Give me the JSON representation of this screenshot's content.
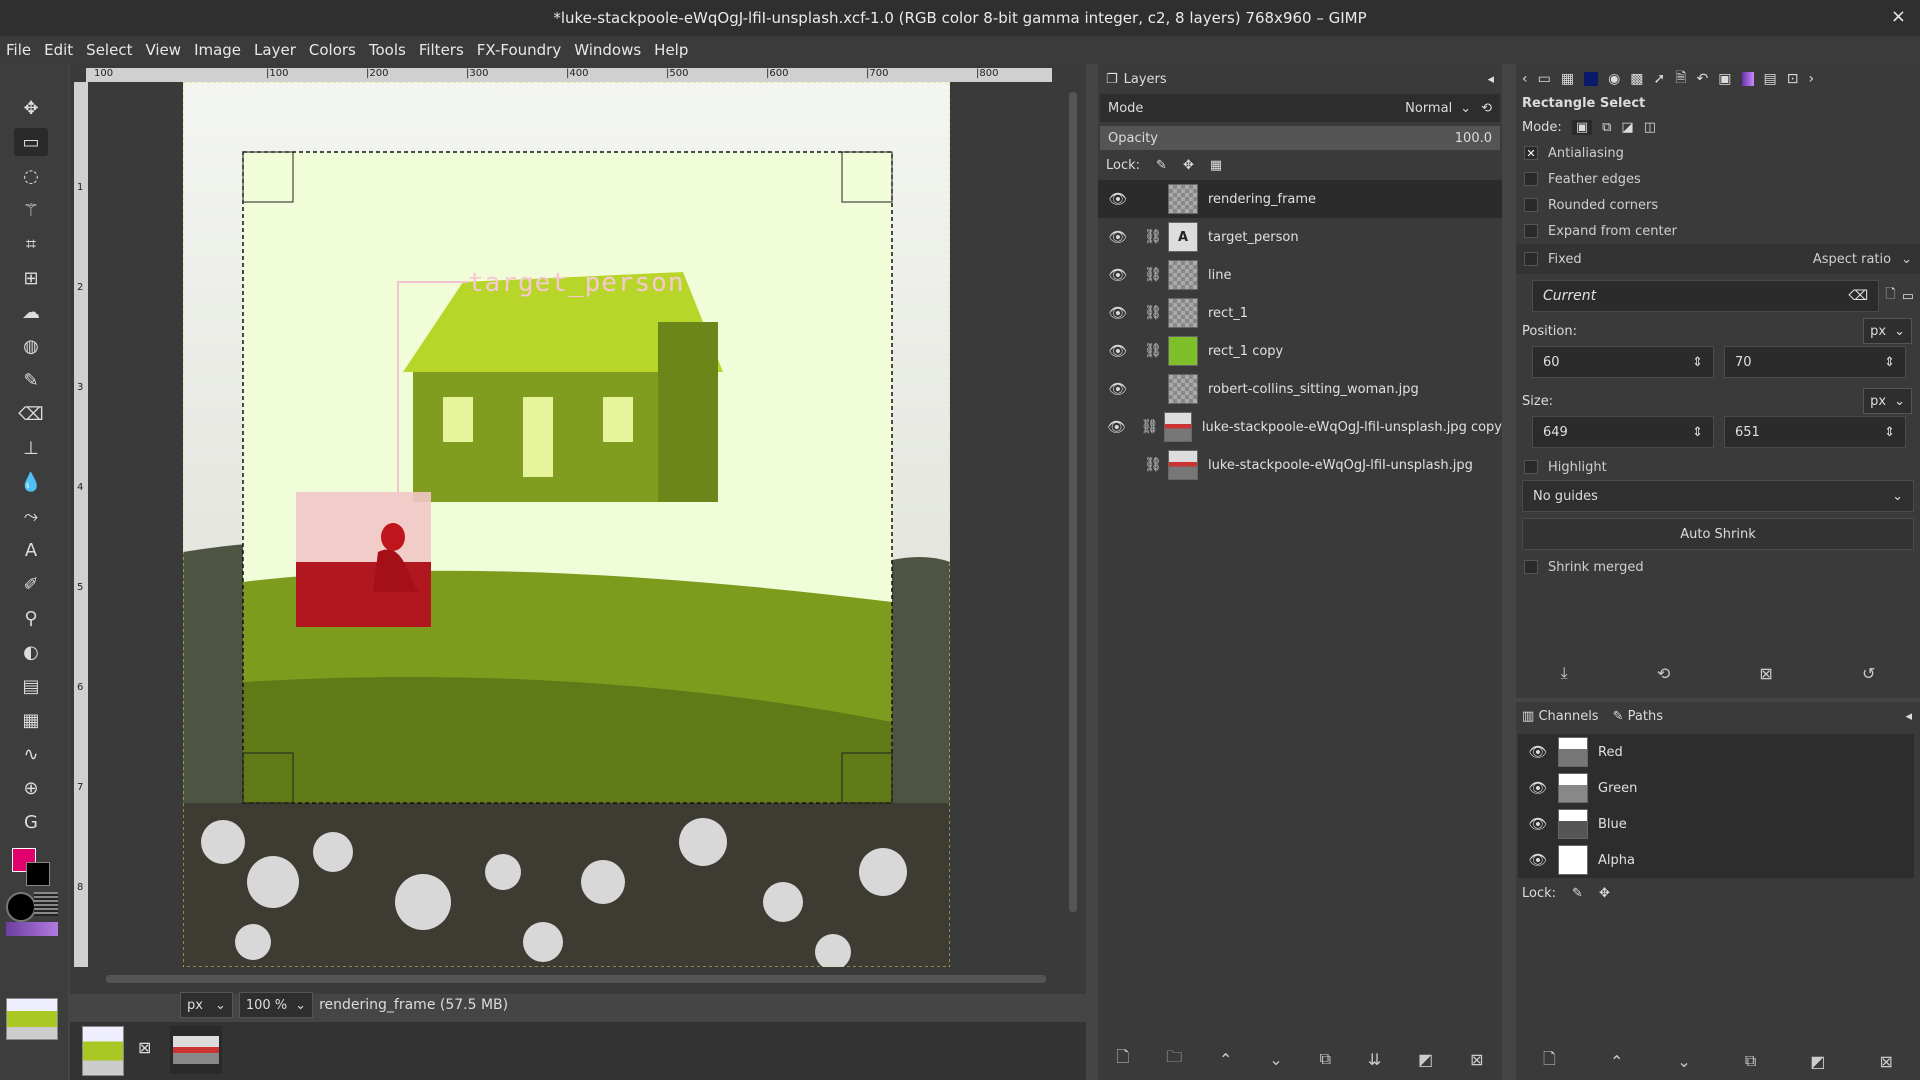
{
  "window": {
    "title": "*luke-stackpoole-eWqOgJ-lfiI-unsplash.xcf-1.0 (RGB color 8-bit gamma integer, c2, 8 layers) 768x960 – GIMP",
    "close": "×"
  },
  "menu": [
    "File",
    "Edit",
    "Select",
    "View",
    "Image",
    "Layer",
    "Colors",
    "Tools",
    "Filters",
    "FX-Foundry",
    "Windows",
    "Help"
  ],
  "toolbox": {
    "tools": [
      "move-icon",
      "rect-select-icon",
      "lasso-icon",
      "fuzzy-select-icon",
      "crop-icon",
      "transform-icon",
      "warp-icon",
      "bucket-fill-icon",
      "paintbrush-icon",
      "eraser-icon",
      "clone-icon",
      "smudge-icon",
      "path-icon",
      "text-icon",
      "color-picker-icon",
      "zoom-icon",
      "dodge-icon",
      "levels-icon",
      "curves-icon",
      "histogram-icon",
      "measure-icon",
      "gmic-icon"
    ],
    "fg_color": "#e0006e",
    "bg_color": "#000000"
  },
  "ruler": {
    "top_ticks": [
      "100",
      "|100",
      "|200",
      "|300",
      "|400",
      "|500",
      "|600",
      "|700",
      "|800"
    ],
    "left_ticks": [
      "1",
      "2",
      "3",
      "4",
      "5",
      "6",
      "7",
      "8"
    ]
  },
  "canvas": {
    "label": "target_person",
    "house_color": "#a9c823"
  },
  "status": {
    "unit": "px",
    "zoom": "100 %",
    "info": "rendering_frame (57.5 MB)"
  },
  "layers": {
    "tab": "Layers",
    "mode_label": "Mode",
    "mode_value": "Normal",
    "opacity_label": "Opacity",
    "opacity_value": "100.0",
    "lock_label": "Lock:",
    "items": [
      {
        "name": "rendering_frame",
        "chain": false,
        "visible": true
      },
      {
        "name": "target_person",
        "chain": true,
        "visible": true
      },
      {
        "name": "line",
        "chain": true,
        "visible": true
      },
      {
        "name": "rect_1",
        "chain": true,
        "visible": true
      },
      {
        "name": "rect_1 copy",
        "chain": true,
        "visible": true
      },
      {
        "name": "robert-collins_sitting_woman.jpg",
        "chain": false,
        "visible": true
      },
      {
        "name": "luke-stackpoole-eWqOgJ-lfiI-unsplash.jpg copy",
        "chain": true,
        "visible": true
      },
      {
        "name": "luke-stackpoole-eWqOgJ-lfiI-unsplash.jpg",
        "chain": true,
        "visible": false
      }
    ]
  },
  "tool_options": {
    "title": "Rectangle Select",
    "mode_label": "Mode:",
    "antialiasing": "Antialiasing",
    "feather": "Feather edges",
    "rounded": "Rounded corners",
    "expand": "Expand from center",
    "fixed": "Fixed",
    "aspect": "Aspect ratio",
    "current": "Current",
    "position_label": "Position:",
    "pos_x": "60",
    "pos_y": "70",
    "size_label": "Size:",
    "size_w": "649",
    "size_h": "651",
    "unit": "px",
    "highlight": "Highlight",
    "guides": "No guides",
    "auto_shrink": "Auto Shrink",
    "shrink_merged": "Shrink merged"
  },
  "channels": {
    "tab_channels": "Channels",
    "tab_paths": "Paths",
    "items": [
      "Red",
      "Green",
      "Blue",
      "Alpha"
    ],
    "lock_label": "Lock:"
  }
}
